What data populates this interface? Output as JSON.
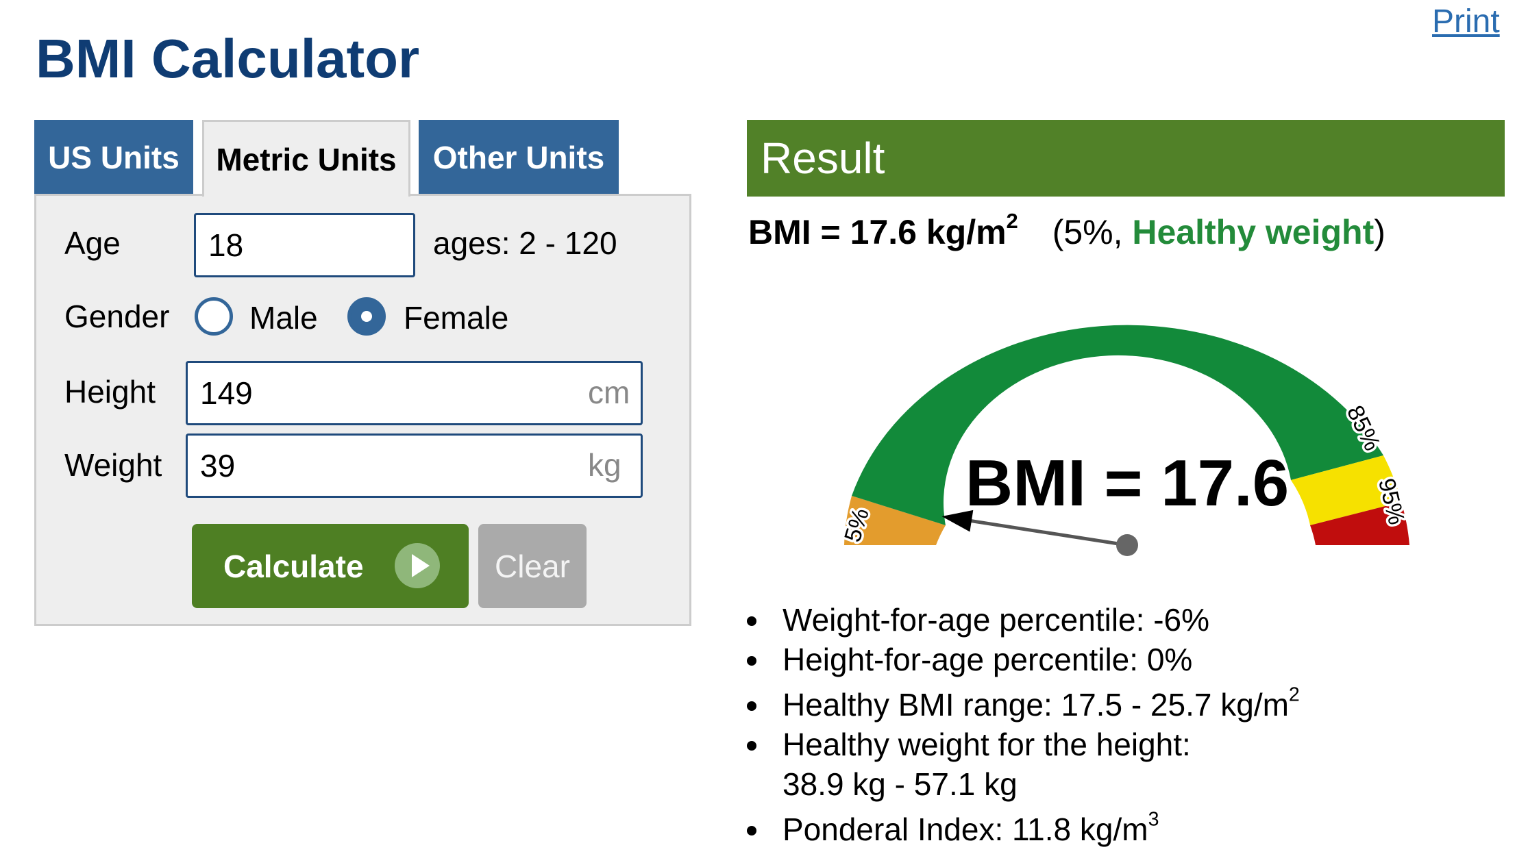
{
  "header": {
    "title": "BMI Calculator",
    "print_label": "Print"
  },
  "tabs": [
    {
      "label": "US Units",
      "active": false
    },
    {
      "label": "Metric Units",
      "active": true
    },
    {
      "label": "Other Units",
      "active": false
    }
  ],
  "form": {
    "age": {
      "label": "Age",
      "value": "18",
      "hint": "ages: 2 - 120"
    },
    "gender": {
      "label": "Gender",
      "options": [
        "Male",
        "Female"
      ],
      "selected": "Female"
    },
    "height": {
      "label": "Height",
      "value": "149",
      "unit": "cm"
    },
    "weight": {
      "label": "Weight",
      "value": "39",
      "unit": "kg"
    },
    "calculate_label": "Calculate",
    "clear_label": "Clear"
  },
  "result": {
    "header": "Result",
    "bmi_prefix": "BMI = 17.6 kg/m",
    "bmi_sup": "2",
    "percentile_open": "(5%, ",
    "category": "Healthy weight",
    "percentile_close": ")",
    "gauge": {
      "label": "BMI = 17.6",
      "marks": [
        "5%",
        "85%",
        "95%"
      ],
      "needle_fraction": 0.05
    },
    "details": {
      "weight_percentile": "Weight-for-age percentile: -6%",
      "height_percentile": "Height-for-age percentile: 0%",
      "healthy_range": "Healthy BMI range: 17.5 - 25.7 kg/m",
      "healthy_range_sup": "2",
      "healthy_weight_line1": "Healthy weight for the height:",
      "healthy_weight_line2": "38.9 kg - 57.1 kg",
      "ponderal": "Ponderal Index: 11.8 kg/m",
      "ponderal_sup": "3"
    }
  },
  "colors": {
    "title": "#0f3c73",
    "tab_inactive": "#336699",
    "result_header": "#518128",
    "calculate_button": "#4e7f23",
    "gauge_underweight": "#e39c2d",
    "gauge_healthy": "#128a3a",
    "gauge_overweight": "#f6e100",
    "gauge_obese": "#c00d0d",
    "healthy_text": "#238b3a"
  }
}
